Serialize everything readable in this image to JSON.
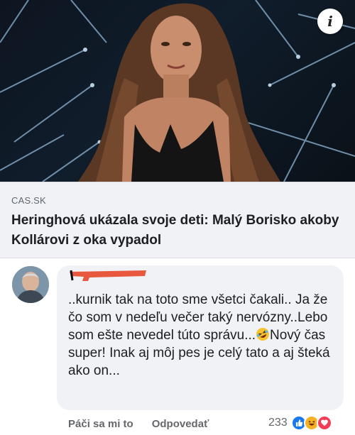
{
  "post": {
    "info_icon_glyph": "i",
    "link_preview": {
      "source": "CAS.SK",
      "headline": "Heringhová ukázala svoje deti: Malý Borisko akoby Kollárovi z oka vypadol"
    }
  },
  "comment": {
    "text_before_emoji": "..kurnik tak na toto sme všetci čakali.. Ja že čo som v nedeľu večer taký nervózny..Lebo som ešte nevedel túto správu...",
    "emoji": "rolling-on-floor-laughing-emoji",
    "text_after_emoji": "Nový čas super! Inak aj môj pes je celý tato a aj šteká ako on...",
    "actions": {
      "like_label": "Páči sa mi to",
      "reply_label": "Odpovedať"
    },
    "reactions": {
      "count": "233",
      "icons": [
        "like-reaction-icon",
        "haha-reaction-icon",
        "love-reaction-icon"
      ]
    }
  },
  "colors": {
    "bubble_bg": "#f0f2f5",
    "text": "#1c1e21",
    "muted": "#65676b",
    "like_blue": "#1877f2",
    "love_red": "#f33e58",
    "haha_yellow": "#f7b125"
  }
}
